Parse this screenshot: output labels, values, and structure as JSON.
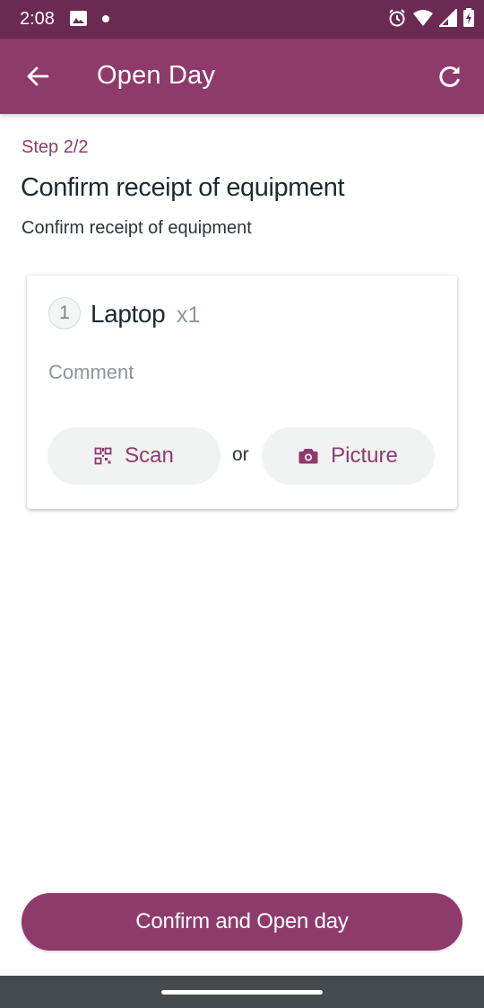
{
  "status_bar": {
    "time": "2:08",
    "icons": [
      "image-icon",
      "notification-dot",
      "alarm-icon",
      "wifi-icon",
      "signal-icon",
      "battery-charging-icon"
    ]
  },
  "app_bar": {
    "title": "Open Day",
    "back_icon": "arrow-back-icon",
    "refresh_icon": "refresh-icon"
  },
  "step_label": "Step 2/2",
  "heading": "Confirm receipt of equipment",
  "subheading": "Confirm receipt of equipment",
  "equipment": [
    {
      "number": "1",
      "name": "Laptop",
      "quantity": "x1",
      "comment_placeholder": "Comment",
      "comment_value": "",
      "scan_label": "Scan",
      "or_label": "or",
      "picture_label": "Picture"
    }
  ],
  "confirm_button": "Confirm and Open day",
  "colors": {
    "status_bar": "#6b2a52",
    "primary": "#8e3b6b",
    "pill_background": "#f1f2f2",
    "navigation_bar": "#444a4e"
  }
}
